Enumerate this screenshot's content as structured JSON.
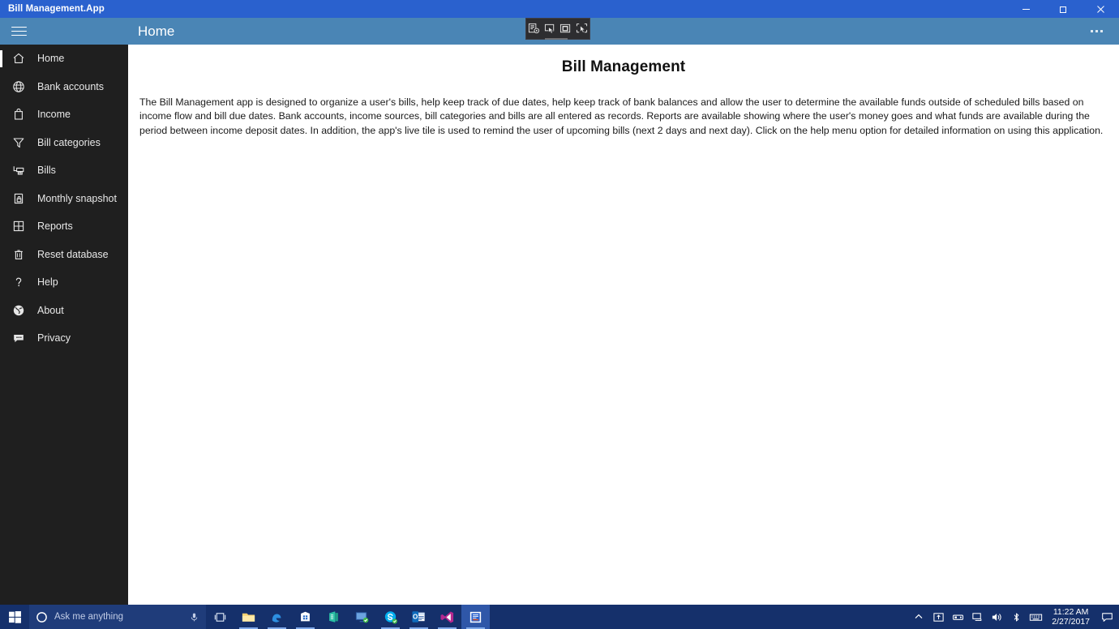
{
  "window": {
    "title": "Bill Management.App",
    "controls": [
      {
        "name": "minimize",
        "label": "Minimize"
      },
      {
        "name": "restore",
        "label": "Restore"
      },
      {
        "name": "close",
        "label": "Close"
      }
    ]
  },
  "header": {
    "menu_icon": "hamburger-icon",
    "page_title": "Home",
    "overflow_label": "More options",
    "bg_color": "#4a85b5",
    "titlebar_color": "#2a61ce"
  },
  "vs_toolbar": {
    "buttons": [
      {
        "name": "go-to-live-visual-tree-icon",
        "label": "Go to Live Visual Tree"
      },
      {
        "name": "select-element-icon",
        "label": "Enable selection"
      },
      {
        "name": "display-layout-adorners-icon",
        "label": "Display layout adorners"
      },
      {
        "name": "track-focused-element-icon",
        "label": "Track focused element"
      }
    ]
  },
  "sidebar": {
    "selected": "Home",
    "items": [
      {
        "label": "Home",
        "icon": "home-icon",
        "selected": true
      },
      {
        "label": "Bank accounts",
        "icon": "globe-icon",
        "selected": false
      },
      {
        "label": "Income",
        "icon": "bag-icon",
        "selected": false
      },
      {
        "label": "Bill categories",
        "icon": "funnel-icon",
        "selected": false
      },
      {
        "label": "Bills",
        "icon": "printer-icon",
        "selected": false
      },
      {
        "label": "Monthly snapshot",
        "icon": "page-lock-icon",
        "selected": false
      },
      {
        "label": "Reports",
        "icon": "grid-icon",
        "selected": false
      },
      {
        "label": "Reset database",
        "icon": "trash-icon",
        "selected": false
      },
      {
        "label": "Help",
        "icon": "question-icon",
        "selected": false
      },
      {
        "label": "About",
        "icon": "globe-filled-icon",
        "selected": false
      },
      {
        "label": "Privacy",
        "icon": "comment-icon",
        "selected": false
      }
    ]
  },
  "main": {
    "title": "Bill Management",
    "body": "The Bill Management app is designed to organize a user's bills, help keep track of due dates, help keep track of bank balances and allow the user to determine the available funds outside of scheduled bills based on income flow and bill due dates. Bank accounts, income sources, bill categories and bills are all entered as records. Reports are available showing where the user's money goes and what funds are available during the period between income deposit dates.  In addition, the app's live tile is used to remind the user of upcoming bills (next 2 days and next day). Click on the help menu option for detailed information on using this application."
  },
  "taskbar": {
    "start_label": "Start",
    "search_placeholder": "Ask me anything",
    "cortana_icon": "cortana-circle-icon",
    "mic_icon": "microphone-icon",
    "apps": [
      {
        "name": "task-view-icon",
        "label": "Task View",
        "running": false,
        "active": false
      },
      {
        "name": "file-explorer-icon",
        "label": "File Explorer",
        "running": true,
        "active": false
      },
      {
        "name": "edge-icon",
        "label": "Microsoft Edge",
        "running": true,
        "active": false
      },
      {
        "name": "store-icon",
        "label": "Microsoft Store",
        "running": true,
        "active": false
      },
      {
        "name": "office-icon",
        "label": "Office",
        "running": false,
        "active": false
      },
      {
        "name": "remote-desktop-icon",
        "label": "Remote Desktop",
        "running": false,
        "active": false
      },
      {
        "name": "skype-icon",
        "label": "Skype",
        "running": true,
        "active": false
      },
      {
        "name": "outlook-icon",
        "label": "Outlook",
        "running": true,
        "active": false
      },
      {
        "name": "visual-studio-icon",
        "label": "Visual Studio",
        "running": true,
        "active": false
      },
      {
        "name": "bill-management-icon",
        "label": "Bill Management.App",
        "running": true,
        "active": true
      }
    ],
    "tray": [
      {
        "name": "show-hidden-icons-icon",
        "label": "Show hidden icons"
      },
      {
        "name": "upload-icon",
        "label": "Pending uploads"
      },
      {
        "name": "device-icon",
        "label": "Removable media"
      },
      {
        "name": "network-icon",
        "label": "Network"
      },
      {
        "name": "volume-icon",
        "label": "Volume"
      },
      {
        "name": "bluetooth-icon",
        "label": "Bluetooth"
      },
      {
        "name": "touch-keyboard-icon",
        "label": "Touch keyboard"
      }
    ],
    "clock": {
      "time": "11:22 AM",
      "date": "2/27/2017"
    },
    "action_center_label": "Action Center"
  }
}
